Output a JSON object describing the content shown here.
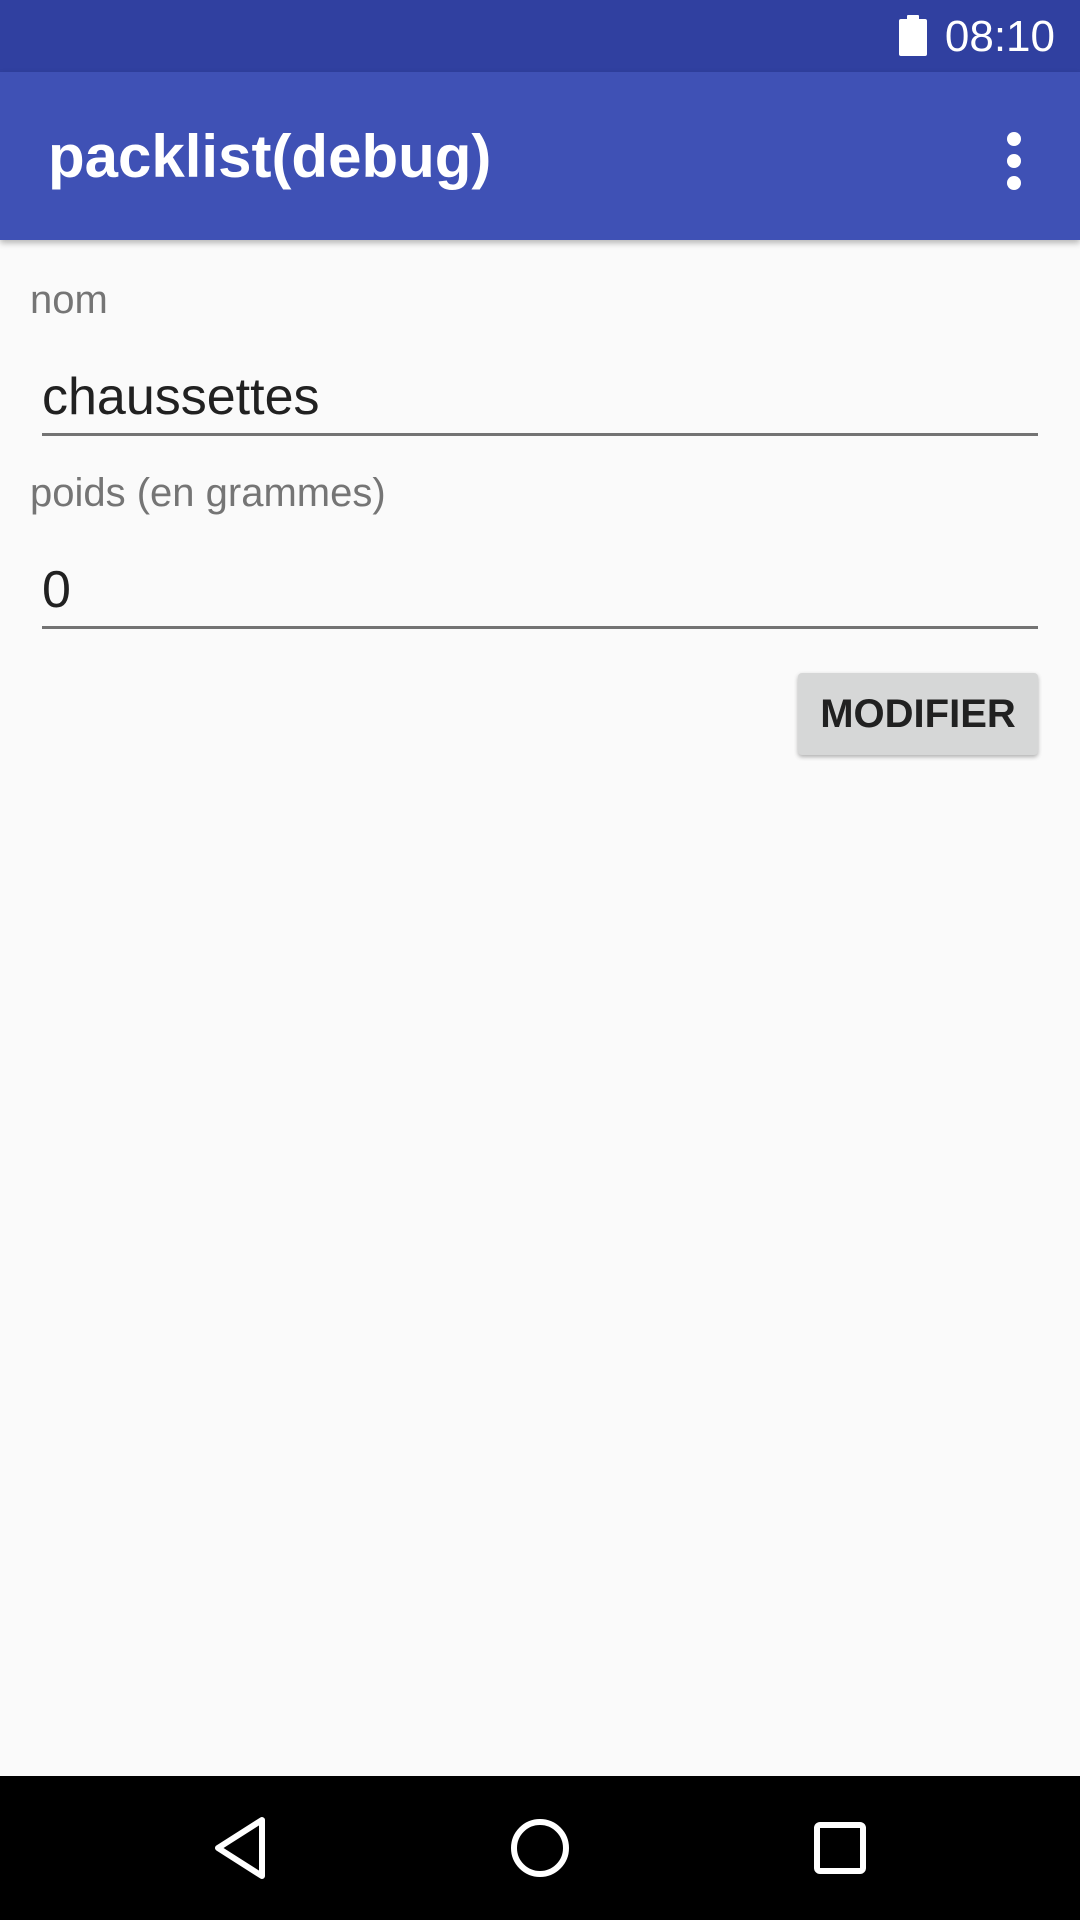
{
  "status_bar": {
    "time": "08:10",
    "battery_icon": "battery-full-icon"
  },
  "app_bar": {
    "title": "packlist(debug)",
    "overflow_icon": "more-vert-icon"
  },
  "form": {
    "name_label": "nom",
    "name_value": "chaussettes",
    "weight_label": "poids (en grammes)",
    "weight_value": "0",
    "submit_label": "MODIFIER"
  },
  "nav_bar": {
    "back_icon": "back-triangle-icon",
    "home_icon": "home-circle-icon",
    "recents_icon": "recents-square-icon"
  },
  "colors": {
    "status_bar": "#3040a0",
    "primary": "#3f51b5",
    "background": "#fafafa",
    "button": "#d6d7d7",
    "nav_bar": "#000000"
  }
}
